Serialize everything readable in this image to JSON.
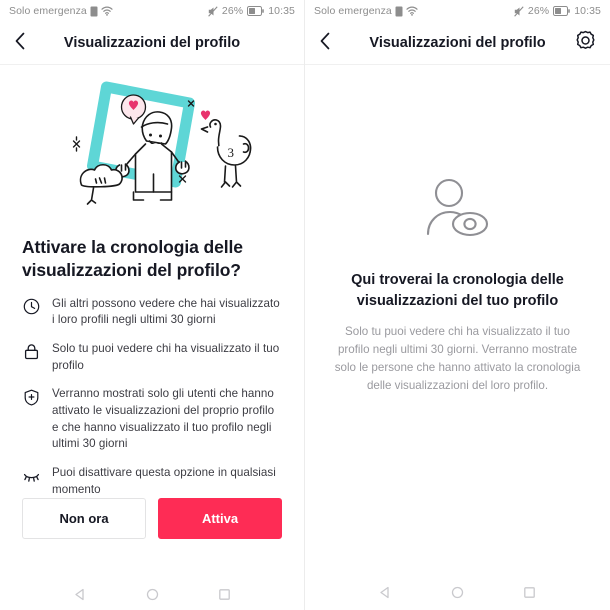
{
  "screens": [
    {
      "statusbar": {
        "carrier": "Solo emergenza",
        "sim_icon": "sim-card-icon",
        "wifi_icon": "wifi-icon",
        "mute_icon": "mute-icon",
        "battery_percent": "26%",
        "battery_icon": "battery-icon",
        "clock": "10:35"
      },
      "header": {
        "back_icon": "chevron-left-icon",
        "title": "Visualizzazioni del profilo",
        "has_gear": false,
        "gear_icon": "gear-icon"
      },
      "illustration": {
        "name": "person-holding-frame-illustration",
        "frame_color": "#5ed6d6",
        "heart_color": "#fe4068",
        "line_color": "#1a1a1a"
      },
      "headline": "Attivare la cronologia delle visualizzazioni del profilo?",
      "features": [
        {
          "icon": "clock-icon",
          "text": "Gli altri possono vedere che hai visualizzato i loro profili negli ultimi 30 giorni"
        },
        {
          "icon": "lock-icon",
          "text": "Solo tu puoi vedere chi ha visualizzato il tuo profilo"
        },
        {
          "icon": "shield-plus-icon",
          "text": "Verranno mostrati solo gli utenti che hanno attivato le visualizzazioni del proprio profilo e che hanno visualizzato il tuo profilo negli ultimi 30 giorni"
        },
        {
          "icon": "eye-off-icon",
          "text": "Puoi disattivare questa opzione in qualsiasi momento"
        }
      ],
      "buttons": {
        "secondary_label": "Non ora",
        "primary_label": "Attiva",
        "primary_color": "#fe2c55"
      },
      "navbar": {
        "back_icon": "nav-back-triangle-icon",
        "home_icon": "nav-home-circle-icon",
        "recents_icon": "nav-recents-square-icon"
      }
    },
    {
      "statusbar": {
        "carrier": "Solo emergenza",
        "sim_icon": "sim-card-icon",
        "wifi_icon": "wifi-icon",
        "mute_icon": "mute-icon",
        "battery_percent": "26%",
        "battery_icon": "battery-icon",
        "clock": "10:35"
      },
      "header": {
        "back_icon": "chevron-left-icon",
        "title": "Visualizzazioni del profilo",
        "has_gear": true,
        "gear_icon": "gear-icon"
      },
      "empty_state": {
        "icon": "person-eye-icon",
        "title": "Qui troverai la cronologia delle visualizzazioni del tuo profilo",
        "description": "Solo tu puoi vedere chi ha visualizzato il tuo profilo negli ultimi 30 giorni. Verranno mostrate solo le persone che hanno attivato la cronologia delle visualizzazioni del loro profilo."
      },
      "navbar": {
        "back_icon": "nav-back-triangle-icon",
        "home_icon": "nav-home-circle-icon",
        "recents_icon": "nav-recents-square-icon"
      }
    }
  ]
}
